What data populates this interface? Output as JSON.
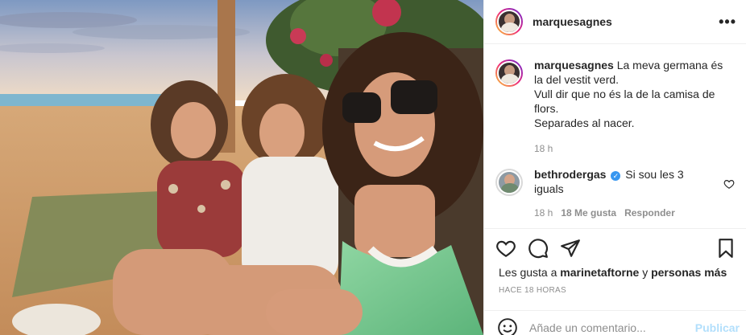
{
  "post": {
    "username": "marquesagnes",
    "more_icon": "more-options-icon"
  },
  "caption": {
    "username": "marquesagnes",
    "lines": [
      "La meva germana és la del vestit verd.",
      "Vull dir que no és la de la camisa de flors.",
      "Separades al nacer."
    ],
    "time": "18 h"
  },
  "comment": {
    "username": "bethrodergas",
    "text": "Si sou les 3 iguals",
    "time": "18 h",
    "likes": "18 Me gusta",
    "reply": "Responder"
  },
  "actions": {
    "icons": [
      "heart-icon",
      "comment-icon",
      "share-icon",
      "bookmark-icon"
    ]
  },
  "likes": {
    "prefix": "Les gusta a",
    "user": "marinetaftorne",
    "connector": "y",
    "others": "personas más"
  },
  "posted": "HACE 18 HORAS",
  "add_comment": {
    "placeholder": "Añade un comentario...",
    "publish": "Publicar"
  },
  "colors": {
    "link_blue": "#3897f0",
    "publish_disabled": "#b2dffc",
    "muted": "#8e8e8e"
  }
}
